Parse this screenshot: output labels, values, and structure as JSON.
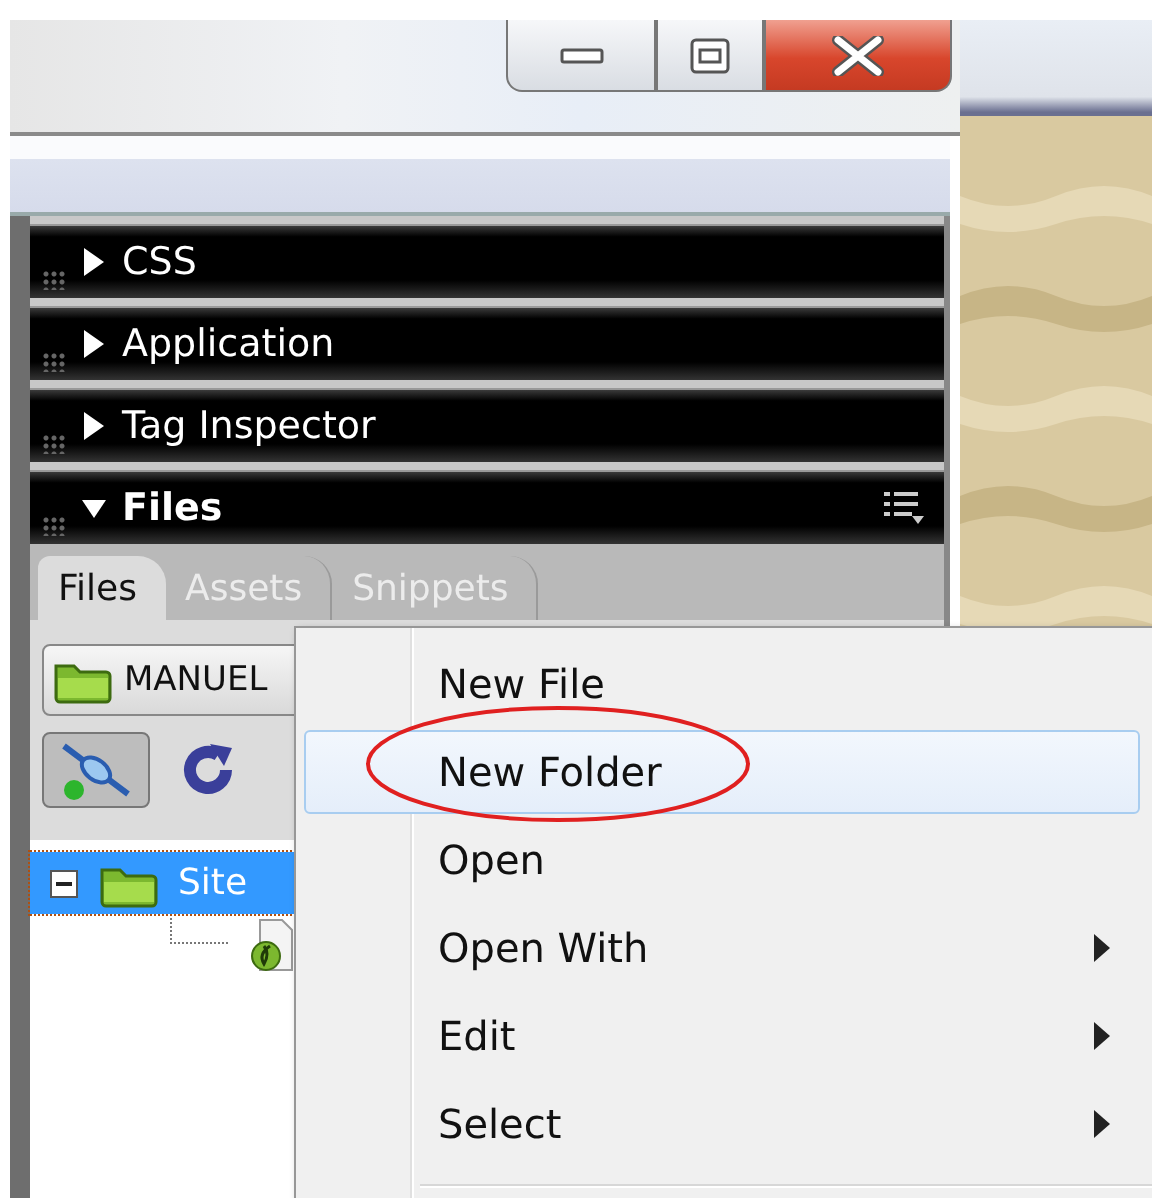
{
  "panels": [
    {
      "title": "CSS",
      "expanded": false
    },
    {
      "title": "Application",
      "expanded": false
    },
    {
      "title": "Tag Inspector",
      "expanded": false
    },
    {
      "title": "Files",
      "expanded": true
    }
  ],
  "files_panel": {
    "tabs": [
      {
        "label": "Files",
        "selected": true
      },
      {
        "label": "Assets",
        "selected": false
      },
      {
        "label": "Snippets",
        "selected": false
      }
    ],
    "site_selector": {
      "value": "MANUEL"
    },
    "tree": [
      {
        "label": "Site",
        "selected": true,
        "expanded": true,
        "children": [
          {
            "kind": "file"
          }
        ]
      }
    ]
  },
  "context_menu": {
    "items": [
      {
        "label": "New File",
        "selected": false,
        "submenu": false,
        "circled": false
      },
      {
        "label": "New Folder",
        "selected": true,
        "submenu": false,
        "circled": true
      },
      {
        "label": "Open",
        "selected": false,
        "submenu": false,
        "circled": false
      },
      {
        "label": "Open With",
        "selected": false,
        "submenu": true,
        "circled": false
      },
      {
        "label": "Edit",
        "selected": false,
        "submenu": true,
        "circled": false
      },
      {
        "label": "Select",
        "selected": false,
        "submenu": true,
        "circled": false
      }
    ]
  }
}
